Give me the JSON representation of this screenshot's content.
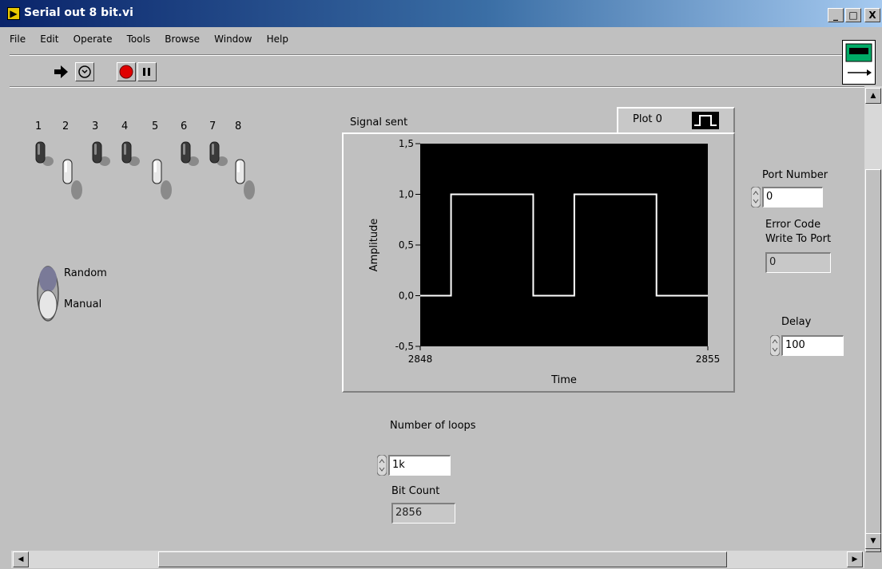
{
  "window": {
    "title": "Serial out 8 bit.vi",
    "minimize": "_",
    "maximize": "□",
    "close": "X"
  },
  "menu": [
    "File",
    "Edit",
    "Operate",
    "Tools",
    "Browse",
    "Window",
    "Help"
  ],
  "toolbar": {
    "run": "run-arrow-icon",
    "run_continuous": "run-continuously-icon",
    "abort": "abort-icon",
    "pause": "pause-icon"
  },
  "switches": {
    "labels": [
      "1",
      "2",
      "3",
      "4",
      "5",
      "6",
      "7",
      "8"
    ],
    "states": [
      true,
      false,
      true,
      true,
      false,
      true,
      true,
      false
    ]
  },
  "mode_switch": {
    "top_label": "Random",
    "bottom_label": "Manual",
    "state": "Manual"
  },
  "graph": {
    "label": "Signal sent",
    "legend_label": "Plot 0",
    "colors": {
      "plot_bg": "#000000",
      "trace": "#ffffff"
    }
  },
  "port_number": {
    "label": "Port Number",
    "value": "0"
  },
  "error_code": {
    "label_line1": "Error Code",
    "label_line2": "Write To Port",
    "value": "0"
  },
  "delay": {
    "label": "Delay",
    "value": "100"
  },
  "loops": {
    "label": "Number of loops",
    "value": "1k"
  },
  "bit_count": {
    "label": "Bit Count",
    "value": "2856"
  },
  "chart_data": {
    "type": "line",
    "title": "Signal sent",
    "xlabel": "Time",
    "ylabel": "Amplitude",
    "x_ticks": [
      "2848",
      "2855"
    ],
    "y_ticks": [
      "1,5",
      "1,0",
      "0,5",
      "0,0",
      "-0,5"
    ],
    "xlim": [
      2848,
      2855
    ],
    "ylim": [
      -0.5,
      1.5
    ],
    "step": true,
    "series": [
      {
        "name": "Plot 0",
        "x": [
          2848,
          2848.75,
          2848.75,
          2850.75,
          2850.75,
          2851.75,
          2851.75,
          2853.75,
          2853.75,
          2855
        ],
        "values": [
          0,
          0,
          1,
          1,
          0,
          0,
          1,
          1,
          0,
          0
        ]
      }
    ]
  }
}
